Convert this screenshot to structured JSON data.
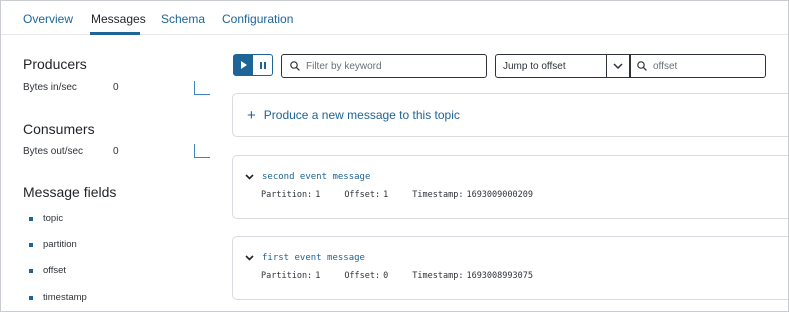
{
  "tabs": [
    {
      "label": "Overview"
    },
    {
      "label": "Messages"
    },
    {
      "label": "Schema"
    },
    {
      "label": "Configuration"
    }
  ],
  "active_tab": "Messages",
  "accent_color": "#1e6496",
  "producers": {
    "title": "Producers",
    "metric_label": "Bytes in/sec",
    "metric_value": "0"
  },
  "consumers": {
    "title": "Consumers",
    "metric_label": "Bytes out/sec",
    "metric_value": "0"
  },
  "message_fields": {
    "title": "Message fields",
    "items": [
      "topic",
      "partition",
      "offset",
      "timestamp"
    ]
  },
  "toolbar": {
    "filter_placeholder": "Filter by keyword",
    "filter_value": "",
    "jump_select_value": "Jump to offset",
    "offset_placeholder": "offset",
    "offset_value": ""
  },
  "produce": {
    "label": "Produce a new message to this topic"
  },
  "messages": [
    {
      "title": "second event message",
      "partition_label": "Partition:",
      "partition": "1",
      "offset_label": "Offset:",
      "offset": "1",
      "timestamp_label": "Timestamp:",
      "timestamp": "1693009000209"
    },
    {
      "title": "first event message",
      "partition_label": "Partition:",
      "partition": "1",
      "offset_label": "Offset:",
      "offset": "0",
      "timestamp_label": "Timestamp:",
      "timestamp": "1693008993075"
    }
  ]
}
